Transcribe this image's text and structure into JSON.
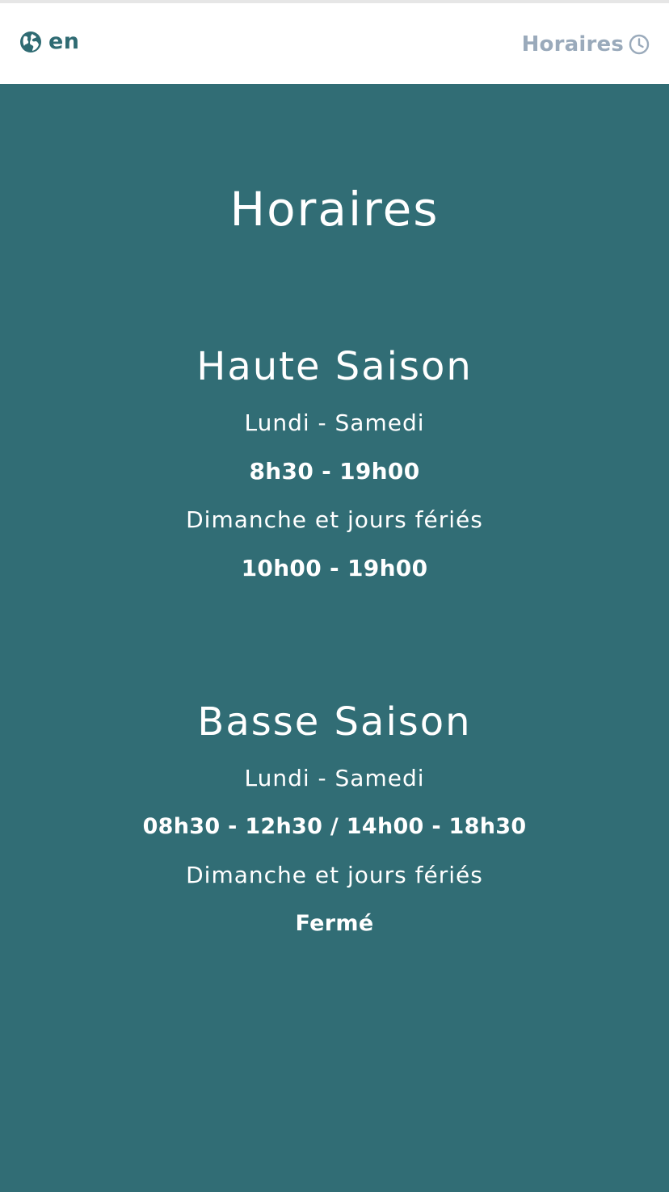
{
  "header": {
    "language_label": "en",
    "hours_link_label": "Horaires",
    "icons": {
      "language": "globe-icon",
      "hours": "clock-icon"
    }
  },
  "main": {
    "title": "Horaires",
    "seasons": [
      {
        "name": "Haute Saison",
        "weekday_label": "Lundi - Samedi",
        "weekday_hours": "8h30 - 19h00",
        "weekend_label": "Dimanche et jours fériés",
        "weekend_hours": "10h00 - 19h00"
      },
      {
        "name": "Basse Saison",
        "weekday_label": "Lundi - Samedi",
        "weekday_hours": "08h30 - 12h30 / 14h00 - 18h30",
        "weekend_label": "Dimanche et jours fériés",
        "weekend_hours": "Fermé"
      }
    ]
  },
  "colors": {
    "background": "#316d75",
    "header_background": "#ffffff",
    "language_text": "#2f6b73",
    "hours_link_text": "#9aaabb",
    "content_text": "#ffffff"
  }
}
